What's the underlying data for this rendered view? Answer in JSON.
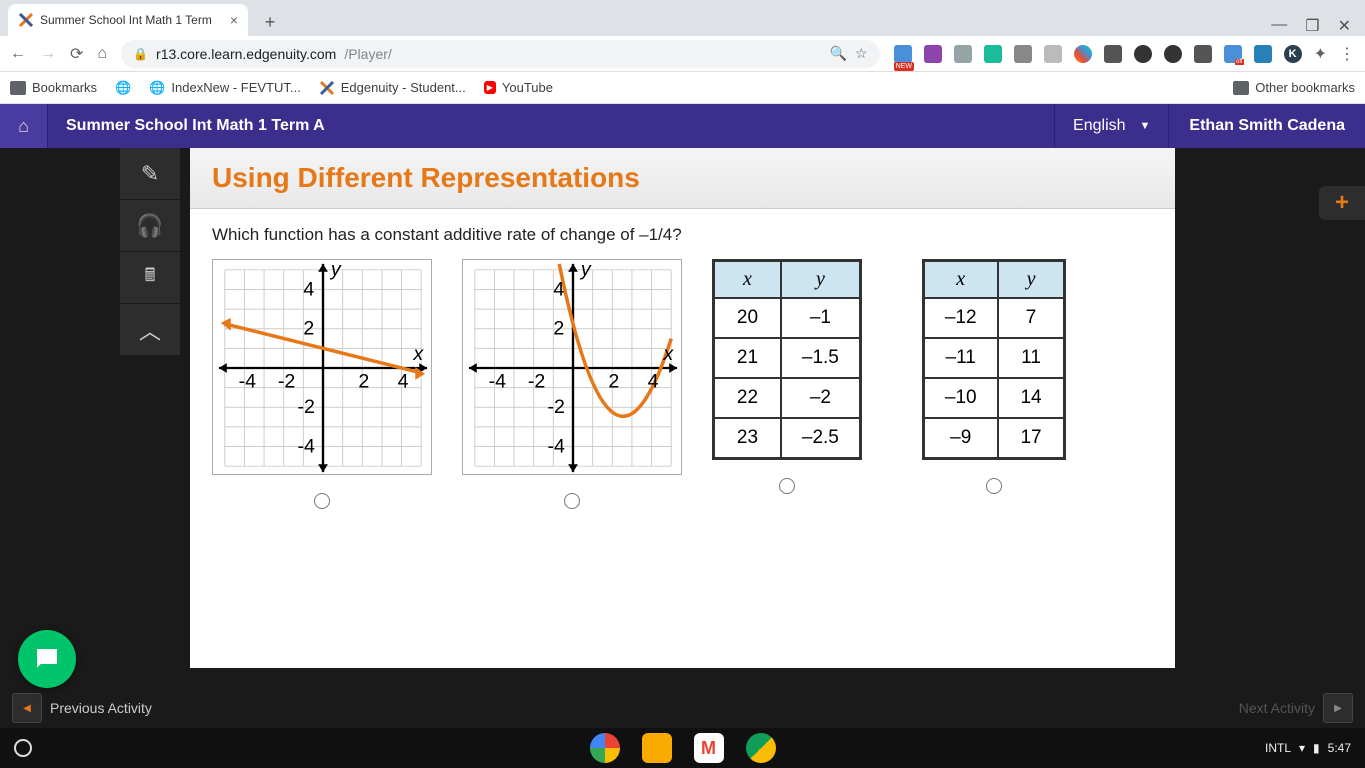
{
  "browser": {
    "tab_title": "Summer School Int Math 1 Term",
    "url_host": "r13.core.learn.edgenuity.com",
    "url_path": "/Player/",
    "new_ext_badge": "NEW"
  },
  "bookmarks": {
    "folder": "Bookmarks",
    "items": [
      "IndexNew - FEVTUT...",
      "Edgenuity - Student...",
      "YouTube"
    ],
    "other": "Other bookmarks"
  },
  "app": {
    "course": "Summer School Int Math 1 Term A",
    "language": "English",
    "user": "Ethan Smith Cadena"
  },
  "lesson": {
    "title": "Using Different Representations",
    "question": "Which function has a constant additive rate of change of –1/4?"
  },
  "chart_data": [
    {
      "type": "line",
      "title": "",
      "xlabel": "x",
      "ylabel": "y",
      "xlim": [
        -5,
        5
      ],
      "ylim": [
        -5,
        5
      ],
      "series": [
        {
          "name": "line",
          "x": [
            -5,
            5
          ],
          "y": [
            2.25,
            -0.25
          ]
        }
      ],
      "ticks_x": [
        -4,
        -2,
        2,
        4
      ],
      "ticks_y": [
        -4,
        -2,
        2,
        4
      ]
    },
    {
      "type": "line",
      "title": "",
      "xlabel": "x",
      "ylabel": "y",
      "xlim": [
        -5,
        5
      ],
      "ylim": [
        -5,
        5
      ],
      "series": [
        {
          "name": "parabola",
          "x": [
            -1,
            0,
            1,
            2,
            3,
            4,
            5
          ],
          "y": [
            5,
            1.5,
            -1,
            -2.5,
            -2.3,
            -0.8,
            2
          ]
        }
      ],
      "ticks_x": [
        -4,
        -2,
        2,
        4
      ],
      "ticks_y": [
        -4,
        -2,
        2,
        4
      ]
    }
  ],
  "tables": [
    {
      "headers": [
        "x",
        "y"
      ],
      "rows": [
        [
          "20",
          "–1"
        ],
        [
          "21",
          "–1.5"
        ],
        [
          "22",
          "–2"
        ],
        [
          "23",
          "–2.5"
        ]
      ]
    },
    {
      "headers": [
        "x",
        "y"
      ],
      "rows": [
        [
          "–12",
          "7"
        ],
        [
          "–11",
          "11"
        ],
        [
          "–10",
          "14"
        ],
        [
          "–9",
          "17"
        ]
      ]
    }
  ],
  "nav": {
    "prev": "Previous Activity",
    "next": "Next Activity"
  },
  "shelf": {
    "ime": "INTL",
    "time": "5:47"
  }
}
